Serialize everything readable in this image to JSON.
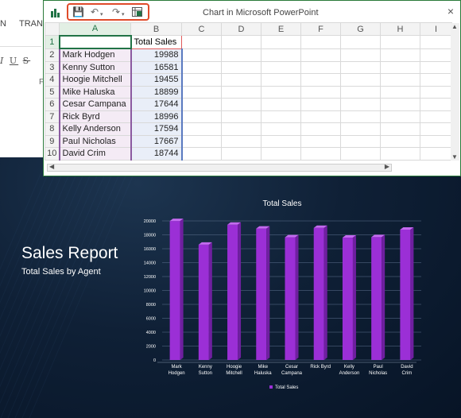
{
  "ppt": {
    "tab_left": "N",
    "tab_trans": "TRANS",
    "fmt_i": "I",
    "fmt_u": "U",
    "fmt_s": "S",
    "fmt_f": "F"
  },
  "excel": {
    "window_title": "Chart in Microsoft PowerPoint",
    "close_glyph": "×",
    "qat": {
      "save": "💾",
      "undo": "↶",
      "redo": "↷"
    },
    "columns": [
      "A",
      "B",
      "C",
      "D",
      "E",
      "F",
      "G",
      "H",
      "I"
    ],
    "header_row": {
      "row": "1",
      "a": "",
      "b": "Total Sales"
    },
    "rows": [
      {
        "row": "2",
        "name": "Mark Hodgen",
        "sales": "19988"
      },
      {
        "row": "3",
        "name": "Kenny Sutton",
        "sales": "16581"
      },
      {
        "row": "4",
        "name": "Hoogie Mitchell",
        "sales": "19455"
      },
      {
        "row": "5",
        "name": "Mike Haluska",
        "sales": "18899"
      },
      {
        "row": "6",
        "name": "Cesar Campana",
        "sales": "17644"
      },
      {
        "row": "7",
        "name": "Rick Byrd",
        "sales": "18996"
      },
      {
        "row": "8",
        "name": "Kelly Anderson",
        "sales": "17594"
      },
      {
        "row": "9",
        "name": "Paul Nicholas",
        "sales": "17667"
      },
      {
        "row": "10",
        "name": "David Crim",
        "sales": "18744"
      }
    ]
  },
  "slide": {
    "title": "Sales Report",
    "subtitle": "Total Sales by Agent"
  },
  "chart_data": {
    "type": "bar",
    "title": "Total Sales",
    "categories": [
      [
        "Mark",
        "Hodgen"
      ],
      [
        "Kenny",
        "Sutton"
      ],
      [
        "Hoogie",
        "Mitchell"
      ],
      [
        "Mike",
        "Haluska"
      ],
      [
        "Cesar",
        "Campana"
      ],
      [
        "Rick Byrd"
      ],
      [
        "Kelly",
        "Anderson"
      ],
      [
        "Paul",
        "Nicholas"
      ],
      [
        "David",
        "Crim"
      ]
    ],
    "series": [
      {
        "name": "Total Sales",
        "values": [
          19988,
          16581,
          19455,
          18899,
          17644,
          18996,
          17594,
          17667,
          18744
        ],
        "color": "#9b2fd6"
      }
    ],
    "yticks": [
      0,
      2000,
      4000,
      6000,
      8000,
      10000,
      12000,
      14000,
      16000,
      18000,
      20000
    ],
    "ylim": [
      0,
      20000
    ],
    "grid": true,
    "legend": "bottom",
    "style": "3d-column"
  }
}
